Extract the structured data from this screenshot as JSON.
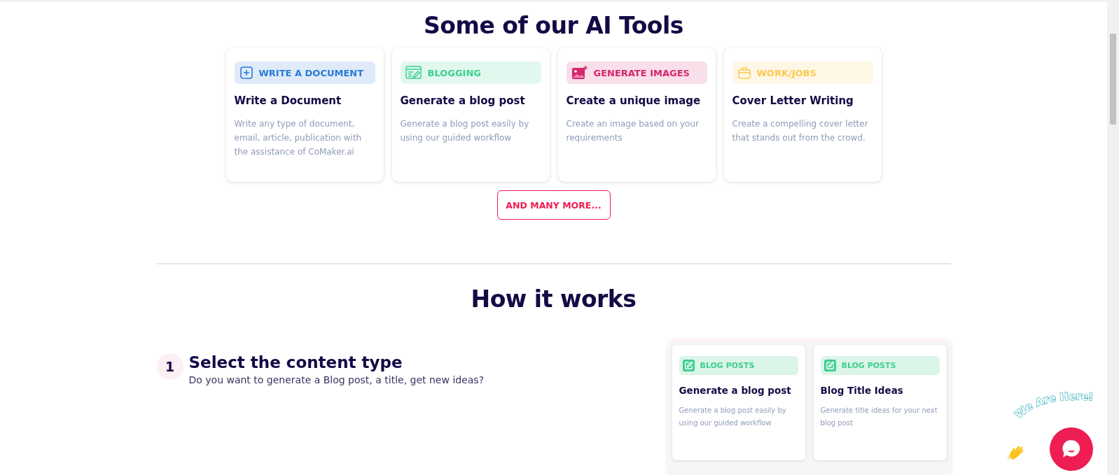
{
  "tools_section": {
    "title": "Some of our AI Tools",
    "cards": [
      {
        "tag": "WRITE A DOCUMENT",
        "kind": "document",
        "color": "#2b7ad6",
        "title": "Write a Document",
        "description": "Write any type of document, email, article, publication with the assistance of CoMaker.ai"
      },
      {
        "tag": "BLOGGING",
        "kind": "blogging",
        "color": "#3ccf8e",
        "title": "Generate a blog post",
        "description": "Generate a blog post easily by using our guided workflow"
      },
      {
        "tag": "GENERATE IMAGES",
        "kind": "images",
        "color": "#d6266e",
        "title": "Create a unique image",
        "description": "Create an image based on your requirements"
      },
      {
        "tag": "WORK/JOBS",
        "kind": "work",
        "color": "#fdc94f",
        "title": "Cover Letter Writing",
        "description": "Create a compelling cover letter that stands out from the crowd."
      }
    ],
    "more_button": "AND MANY MORE..."
  },
  "how_section": {
    "title": "How it works",
    "steps": [
      {
        "number": "1",
        "title": "Select the content type",
        "description": "Do you want to generate a Blog post, a title, get new ideas?",
        "preview_cards": [
          {
            "tag": "BLOG POSTS",
            "title": "Generate a blog post",
            "description": "Generate a blog post easily by using our guided workflow"
          },
          {
            "tag": "BLOG POSTS",
            "title": "Blog Title Ideas",
            "description": "Generate title ideas for your next blog post"
          }
        ]
      }
    ]
  },
  "chat_widget": {
    "label": "We Are Here!"
  }
}
